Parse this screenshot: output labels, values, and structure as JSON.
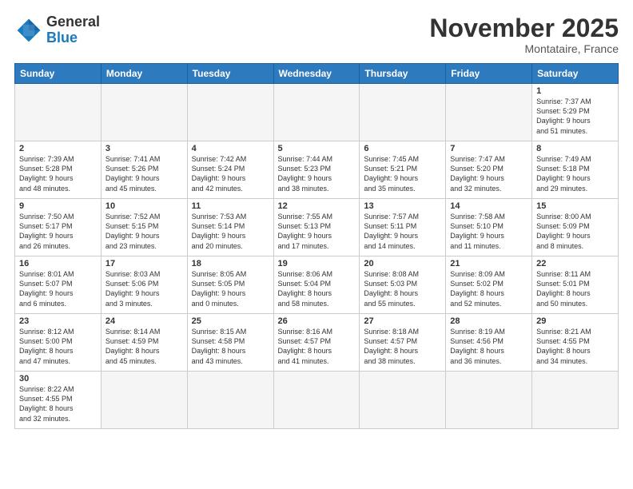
{
  "logo": {
    "line1": "General",
    "line2": "Blue"
  },
  "title": "November 2025",
  "location": "Montataire, France",
  "days_header": [
    "Sunday",
    "Monday",
    "Tuesday",
    "Wednesday",
    "Thursday",
    "Friday",
    "Saturday"
  ],
  "weeks": [
    [
      {
        "day": "",
        "info": "",
        "empty": true
      },
      {
        "day": "",
        "info": "",
        "empty": true
      },
      {
        "day": "",
        "info": "",
        "empty": true
      },
      {
        "day": "",
        "info": "",
        "empty": true
      },
      {
        "day": "",
        "info": "",
        "empty": true
      },
      {
        "day": "",
        "info": "",
        "empty": true
      },
      {
        "day": "1",
        "info": "Sunrise: 7:37 AM\nSunset: 5:29 PM\nDaylight: 9 hours\nand 51 minutes."
      }
    ],
    [
      {
        "day": "2",
        "info": "Sunrise: 7:39 AM\nSunset: 5:28 PM\nDaylight: 9 hours\nand 48 minutes."
      },
      {
        "day": "3",
        "info": "Sunrise: 7:41 AM\nSunset: 5:26 PM\nDaylight: 9 hours\nand 45 minutes."
      },
      {
        "day": "4",
        "info": "Sunrise: 7:42 AM\nSunset: 5:24 PM\nDaylight: 9 hours\nand 42 minutes."
      },
      {
        "day": "5",
        "info": "Sunrise: 7:44 AM\nSunset: 5:23 PM\nDaylight: 9 hours\nand 38 minutes."
      },
      {
        "day": "6",
        "info": "Sunrise: 7:45 AM\nSunset: 5:21 PM\nDaylight: 9 hours\nand 35 minutes."
      },
      {
        "day": "7",
        "info": "Sunrise: 7:47 AM\nSunset: 5:20 PM\nDaylight: 9 hours\nand 32 minutes."
      },
      {
        "day": "8",
        "info": "Sunrise: 7:49 AM\nSunset: 5:18 PM\nDaylight: 9 hours\nand 29 minutes."
      }
    ],
    [
      {
        "day": "9",
        "info": "Sunrise: 7:50 AM\nSunset: 5:17 PM\nDaylight: 9 hours\nand 26 minutes."
      },
      {
        "day": "10",
        "info": "Sunrise: 7:52 AM\nSunset: 5:15 PM\nDaylight: 9 hours\nand 23 minutes."
      },
      {
        "day": "11",
        "info": "Sunrise: 7:53 AM\nSunset: 5:14 PM\nDaylight: 9 hours\nand 20 minutes."
      },
      {
        "day": "12",
        "info": "Sunrise: 7:55 AM\nSunset: 5:13 PM\nDaylight: 9 hours\nand 17 minutes."
      },
      {
        "day": "13",
        "info": "Sunrise: 7:57 AM\nSunset: 5:11 PM\nDaylight: 9 hours\nand 14 minutes."
      },
      {
        "day": "14",
        "info": "Sunrise: 7:58 AM\nSunset: 5:10 PM\nDaylight: 9 hours\nand 11 minutes."
      },
      {
        "day": "15",
        "info": "Sunrise: 8:00 AM\nSunset: 5:09 PM\nDaylight: 9 hours\nand 8 minutes."
      }
    ],
    [
      {
        "day": "16",
        "info": "Sunrise: 8:01 AM\nSunset: 5:07 PM\nDaylight: 9 hours\nand 6 minutes."
      },
      {
        "day": "17",
        "info": "Sunrise: 8:03 AM\nSunset: 5:06 PM\nDaylight: 9 hours\nand 3 minutes."
      },
      {
        "day": "18",
        "info": "Sunrise: 8:05 AM\nSunset: 5:05 PM\nDaylight: 9 hours\nand 0 minutes."
      },
      {
        "day": "19",
        "info": "Sunrise: 8:06 AM\nSunset: 5:04 PM\nDaylight: 8 hours\nand 58 minutes."
      },
      {
        "day": "20",
        "info": "Sunrise: 8:08 AM\nSunset: 5:03 PM\nDaylight: 8 hours\nand 55 minutes."
      },
      {
        "day": "21",
        "info": "Sunrise: 8:09 AM\nSunset: 5:02 PM\nDaylight: 8 hours\nand 52 minutes."
      },
      {
        "day": "22",
        "info": "Sunrise: 8:11 AM\nSunset: 5:01 PM\nDaylight: 8 hours\nand 50 minutes."
      }
    ],
    [
      {
        "day": "23",
        "info": "Sunrise: 8:12 AM\nSunset: 5:00 PM\nDaylight: 8 hours\nand 47 minutes."
      },
      {
        "day": "24",
        "info": "Sunrise: 8:14 AM\nSunset: 4:59 PM\nDaylight: 8 hours\nand 45 minutes."
      },
      {
        "day": "25",
        "info": "Sunrise: 8:15 AM\nSunset: 4:58 PM\nDaylight: 8 hours\nand 43 minutes."
      },
      {
        "day": "26",
        "info": "Sunrise: 8:16 AM\nSunset: 4:57 PM\nDaylight: 8 hours\nand 41 minutes."
      },
      {
        "day": "27",
        "info": "Sunrise: 8:18 AM\nSunset: 4:57 PM\nDaylight: 8 hours\nand 38 minutes."
      },
      {
        "day": "28",
        "info": "Sunrise: 8:19 AM\nSunset: 4:56 PM\nDaylight: 8 hours\nand 36 minutes."
      },
      {
        "day": "29",
        "info": "Sunrise: 8:21 AM\nSunset: 4:55 PM\nDaylight: 8 hours\nand 34 minutes."
      }
    ],
    [
      {
        "day": "30",
        "info": "Sunrise: 8:22 AM\nSunset: 4:55 PM\nDaylight: 8 hours\nand 32 minutes."
      },
      {
        "day": "",
        "info": "",
        "empty": true
      },
      {
        "day": "",
        "info": "",
        "empty": true
      },
      {
        "day": "",
        "info": "",
        "empty": true
      },
      {
        "day": "",
        "info": "",
        "empty": true
      },
      {
        "day": "",
        "info": "",
        "empty": true
      },
      {
        "day": "",
        "info": "",
        "empty": true
      }
    ]
  ]
}
